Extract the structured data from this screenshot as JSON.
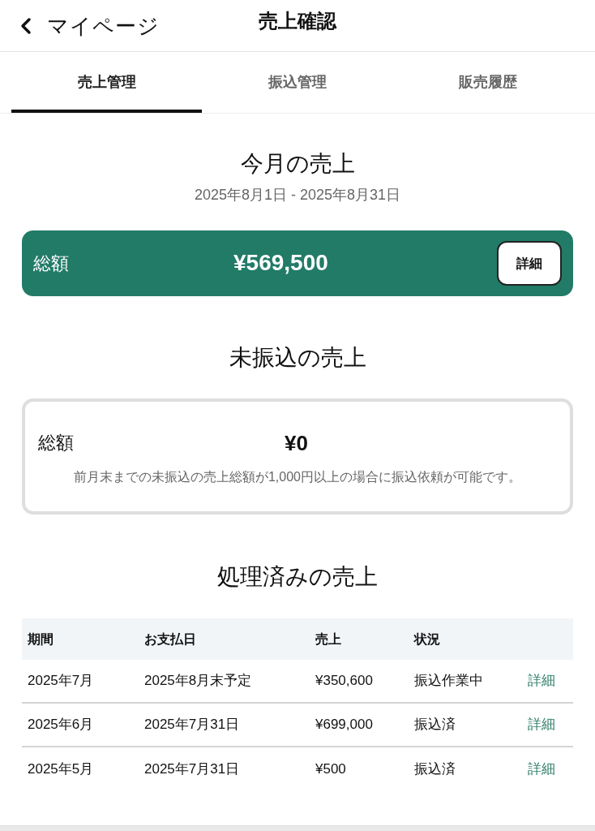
{
  "header": {
    "back_label": "マイページ",
    "title": "売上確認"
  },
  "tabs": [
    {
      "label": "売上管理",
      "selected": true
    },
    {
      "label": "振込管理",
      "selected": false
    },
    {
      "label": "販売履歴",
      "selected": false
    }
  ],
  "this_month": {
    "heading": "今月の売上",
    "period": "2025年8月1日 - 2025年8月31日",
    "total_label": "総額",
    "total": "¥569,500",
    "detail_button": "詳細"
  },
  "unpaid": {
    "heading": "未振込の売上",
    "total_label": "総額",
    "total": "¥0",
    "note": "前月末までの未振込の売上総額が1,000円以上の場合に振込依頼が可能です。"
  },
  "processed": {
    "heading": "処理済みの売上",
    "table": {
      "columns": [
        "期間",
        "お支払日",
        "売上",
        "状況"
      ],
      "rows": [
        {
          "period": "2025年7月",
          "payment_date": "2025年8月末予定",
          "sales": "¥350,600",
          "status": "振込作業中",
          "link": "詳細"
        },
        {
          "period": "2025年6月",
          "payment_date": "2025年7月31日",
          "sales": "¥699,000",
          "status": "振込済",
          "link": "詳細"
        },
        {
          "period": "2025年5月",
          "payment_date": "2025年7月31日",
          "sales": "¥500",
          "status": "振込済",
          "link": "詳細"
        }
      ]
    }
  }
}
